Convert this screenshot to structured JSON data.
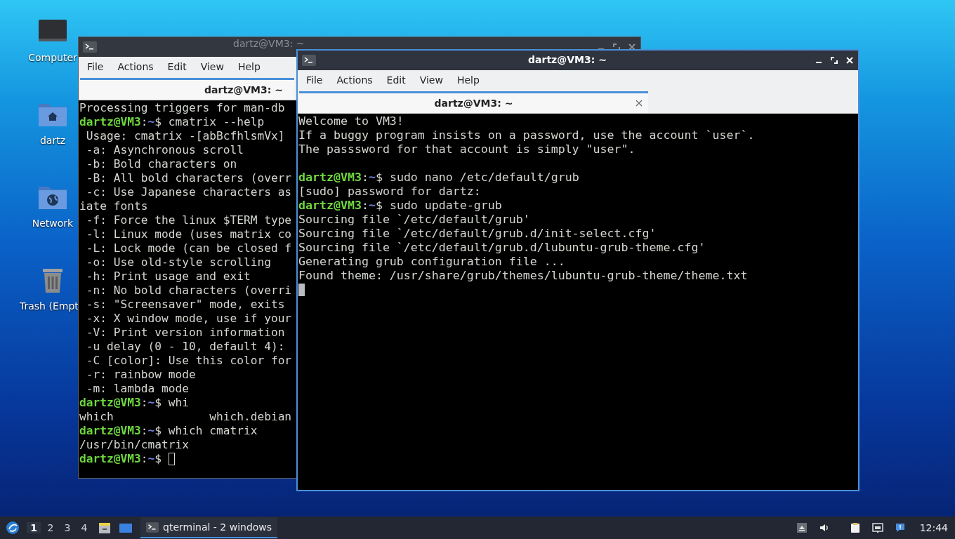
{
  "desktop_icons": [
    {
      "kind": "computer",
      "label": "Computer"
    },
    {
      "kind": "home",
      "label": "dartz"
    },
    {
      "kind": "network",
      "label": "Network"
    },
    {
      "kind": "trash",
      "label": "Trash (Empt"
    }
  ],
  "windows": [
    {
      "title": "dartz@VM3: ~",
      "focused": false,
      "menu": [
        "File",
        "Actions",
        "Edit",
        "View",
        "Help"
      ],
      "tab": "dartz@VM3: ~",
      "lines": [
        {
          "kind": "output",
          "text": "Processing triggers for man-db",
          "cursor": false
        },
        {
          "kind": "prompt",
          "user": "dartz@VM3",
          "colon": ":",
          "path": "~",
          "command": "$ cmatrix --help",
          "cursor": false
        },
        {
          "kind": "output",
          "text": " Usage: cmatrix -[abBcfhlsmVx]",
          "cursor": false
        },
        {
          "kind": "output",
          "text": " -a: Asynchronous scroll",
          "cursor": false
        },
        {
          "kind": "output",
          "text": " -b: Bold characters on",
          "cursor": false
        },
        {
          "kind": "output",
          "text": " -B: All bold characters (overr",
          "cursor": false
        },
        {
          "kind": "output",
          "text": " -c: Use Japanese characters as",
          "cursor": false
        },
        {
          "kind": "output",
          "text": "iate fonts",
          "cursor": false
        },
        {
          "kind": "output",
          "text": " -f: Force the linux $TERM type",
          "cursor": false
        },
        {
          "kind": "output",
          "text": " -l: Linux mode (uses matrix co",
          "cursor": false
        },
        {
          "kind": "output",
          "text": " -L: Lock mode (can be closed f",
          "cursor": false
        },
        {
          "kind": "output",
          "text": " -o: Use old-style scrolling",
          "cursor": false
        },
        {
          "kind": "output",
          "text": " -h: Print usage and exit",
          "cursor": false
        },
        {
          "kind": "output",
          "text": " -n: No bold characters (overri",
          "cursor": false
        },
        {
          "kind": "output",
          "text": " -s: \"Screensaver\" mode, exits",
          "cursor": false
        },
        {
          "kind": "output",
          "text": " -x: X window mode, use if your",
          "cursor": false
        },
        {
          "kind": "output",
          "text": " -V: Print version information",
          "cursor": false
        },
        {
          "kind": "output",
          "text": " -u delay (0 - 10, default 4):",
          "cursor": false
        },
        {
          "kind": "output",
          "text": " -C [color]: Use this color for",
          "cursor": false
        },
        {
          "kind": "output",
          "text": " -r: rainbow mode",
          "cursor": false
        },
        {
          "kind": "output",
          "text": " -m: lambda mode",
          "cursor": false
        },
        {
          "kind": "prompt",
          "user": "dartz@VM3",
          "colon": ":",
          "path": "~",
          "command": "$ whi",
          "cursor": false
        },
        {
          "kind": "output",
          "text": "which              which.debian",
          "cursor": false
        },
        {
          "kind": "prompt",
          "user": "dartz@VM3",
          "colon": ":",
          "path": "~",
          "command": "$ which cmatrix",
          "cursor": false
        },
        {
          "kind": "output",
          "text": "/usr/bin/cmatrix",
          "cursor": false
        },
        {
          "kind": "prompt",
          "user": "dartz@VM3",
          "colon": ":",
          "path": "~",
          "command": "$ ",
          "cursor": true
        }
      ]
    },
    {
      "title": "dartz@VM3: ~",
      "focused": true,
      "menu": [
        "File",
        "Actions",
        "Edit",
        "View",
        "Help"
      ],
      "tab": "dartz@VM3: ~",
      "lines": [
        {
          "kind": "output",
          "text": "Welcome to VM3!",
          "cursor": false
        },
        {
          "kind": "output",
          "text": "If a buggy program insists on a password, use the account `user`.",
          "cursor": false
        },
        {
          "kind": "output",
          "text": "The passsword for that account is simply \"user\".",
          "cursor": false
        },
        {
          "kind": "blank",
          "cursor": false
        },
        {
          "kind": "prompt",
          "user": "dartz@VM3",
          "colon": ":",
          "path": "~",
          "command": "$ sudo nano /etc/default/grub",
          "cursor": false
        },
        {
          "kind": "output",
          "text": "[sudo] password for dartz:",
          "cursor": false
        },
        {
          "kind": "prompt",
          "user": "dartz@VM3",
          "colon": ":",
          "path": "~",
          "command": "$ sudo update-grub",
          "cursor": false
        },
        {
          "kind": "output",
          "text": "Sourcing file `/etc/default/grub'",
          "cursor": false
        },
        {
          "kind": "output",
          "text": "Sourcing file `/etc/default/grub.d/init-select.cfg'",
          "cursor": false
        },
        {
          "kind": "output",
          "text": "Sourcing file `/etc/default/grub.d/lubuntu-grub-theme.cfg'",
          "cursor": false
        },
        {
          "kind": "output",
          "text": "Generating grub configuration file ...",
          "cursor": false
        },
        {
          "kind": "output",
          "text": "Found theme: /usr/share/grub/themes/lubuntu-grub-theme/theme.txt",
          "cursor": false
        },
        {
          "kind": "blank",
          "cursor": true
        }
      ]
    }
  ],
  "taskbar": {
    "workspaces": [
      {
        "label": "1",
        "selected": true
      },
      {
        "label": "2",
        "selected": false
      },
      {
        "label": "3",
        "selected": false
      },
      {
        "label": "4",
        "selected": false
      }
    ],
    "task": {
      "label": "qterminal - 2 windows",
      "active": true
    },
    "clock": "12:44"
  }
}
